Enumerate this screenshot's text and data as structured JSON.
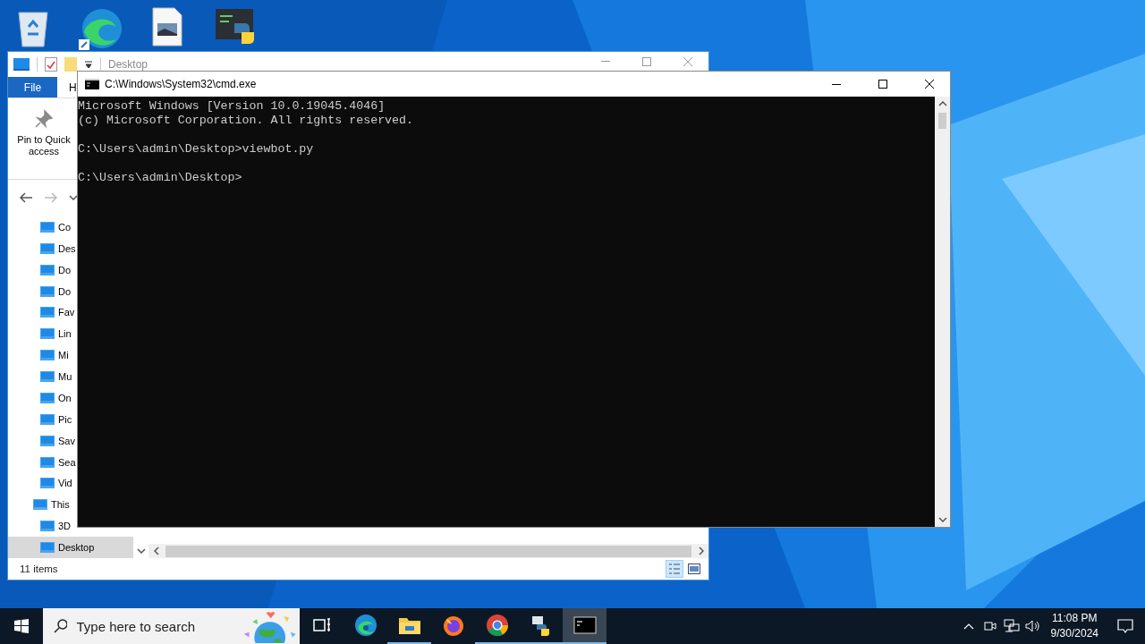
{
  "explorer": {
    "title": "Desktop",
    "ribbon_tabs": [
      {
        "label": "File",
        "kind": "menu"
      },
      {
        "label": "H",
        "kind": "tab"
      }
    ],
    "pin_button": "Pin to Quick access",
    "nav_tree": [
      {
        "label": "Co",
        "selected": false
      },
      {
        "label": "Des",
        "selected": false
      },
      {
        "label": "Do",
        "selected": false
      },
      {
        "label": "Do",
        "selected": false
      },
      {
        "label": "Fav",
        "selected": false
      },
      {
        "label": "Lin",
        "selected": false
      },
      {
        "label": "Mi",
        "selected": false
      },
      {
        "label": "Mu",
        "selected": false
      },
      {
        "label": "On",
        "selected": false
      },
      {
        "label": "Pic",
        "selected": false
      },
      {
        "label": "Sav",
        "selected": false
      },
      {
        "label": "Sea",
        "selected": false
      },
      {
        "label": "Vid",
        "selected": false
      },
      {
        "label": "This",
        "selected": false,
        "children": [
          {
            "label": "3D",
            "selected": false
          },
          {
            "label": "Desktop",
            "selected": true
          }
        ]
      }
    ],
    "status_bar": "11 items",
    "view_buttons": [
      {
        "selected": true
      },
      {
        "selected": false
      }
    ]
  },
  "cmd": {
    "title": "C:\\Windows\\System32\\cmd.exe",
    "output": [
      [
        "Microsoft Windows [Version 10.0.19045.4046]",
        "(c) Microsoft Corporation. All rights reserved."
      ],
      [
        "C:\\Users\\admin\\Desktop>viewbot.py"
      ],
      [
        "C:\\Users\\admin\\Desktop>"
      ]
    ]
  },
  "taskbar": {
    "search": {
      "placeholder": "Type here to search"
    },
    "apps": [
      {
        "running": false,
        "active": false
      },
      {
        "running": false,
        "active": false
      },
      {
        "running": true,
        "active": false
      },
      {
        "running": false,
        "active": false
      },
      {
        "running": true,
        "active": false
      },
      {
        "running": true,
        "active": false
      },
      {
        "running": true,
        "active": true
      }
    ],
    "clock": {
      "time": "11:08 PM",
      "date": "9/30/2024"
    }
  }
}
